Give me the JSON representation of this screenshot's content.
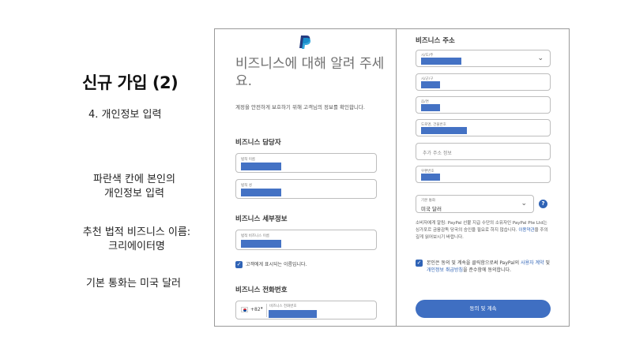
{
  "slide": {
    "title": "신규 가입 (2)",
    "subtitle": "4. 개인정보 입력",
    "note1_line1": "파란색 칸에 본인의",
    "note1_line2": "개인정보 입력",
    "note2_line1": "추천 법적 비즈니스 이름:",
    "note2_line2": "크리에이터명",
    "note3": "기본 통화는 미국 달러"
  },
  "form_left": {
    "heading": "비즈니스에 대해 알려 주세요.",
    "intro": "계정을 안전하게 보호하기 위해 고객님의 정보를 확인합니다.",
    "contact_section": "비즈니스 담당자",
    "legal_first_label": "법적 이름",
    "legal_last_label": "법적 성",
    "detail_section": "비즈니스 세부정보",
    "legal_business_label": "법적 비즈니스 이름",
    "display_checkbox_label": "고객에게 표시되는 이름입니다.",
    "phone_section": "비즈니스 전화번호",
    "country_code": "+82",
    "phone_label": "비즈니스 전화번호"
  },
  "form_right": {
    "address_section": "비즈니스 주소",
    "province_label": "시/도/주",
    "city_label": "시/군/구",
    "district_label": "읍/면",
    "street_label": "도로명, 건물번호",
    "extra_address_placeholder": "추가 주소 정보",
    "postal_label": "우편번호",
    "currency_label": "기본 통화",
    "currency_value": "미국 달러",
    "help_icon_text": "?",
    "notice_text": "소비자에게 알림: PayPal 선불 지급 수단의 소유자인 PayPal Pte Ltd는 싱가포르 금융감독 당국의 승인을 필요로 하지 않습니다.",
    "notice_link": "이용약관",
    "notice_tail": "을 주의 깊게 읽어보시기 바랍니다.",
    "agree_prefix": "본인은 동의 및 계속을 클릭함으로써 PayPal의",
    "agree_link1": "사용자 계약",
    "agree_and": "및",
    "agree_link2": "개인정보 취급방침",
    "agree_suffix": "을 준수함에 동의합니다.",
    "submit_label": "동의 및 계속"
  },
  "colors": {
    "redaction": "#4472c4",
    "accent": "#2f63b6",
    "button": "#3f6fc2"
  }
}
